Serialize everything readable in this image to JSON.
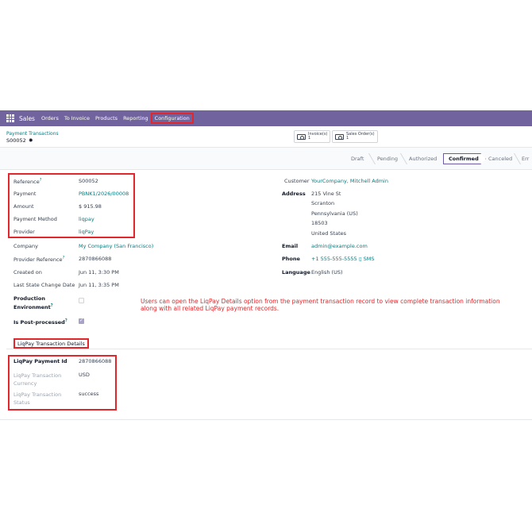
{
  "navbar": {
    "app_name": "Sales",
    "menu": [
      "Orders",
      "To Invoice",
      "Products",
      "Reporting",
      "Configuration"
    ]
  },
  "control_panel": {
    "breadcrumb_parent": "Payment Transactions",
    "record_name": "S00052",
    "smart_buttons": [
      {
        "label": "Invoice(s)",
        "count": "1"
      },
      {
        "label": "Sales Order(s)",
        "count": "1"
      }
    ]
  },
  "statusbar": {
    "stages": [
      "Draft",
      "Pending",
      "Authorized",
      "Confirmed",
      "Canceled",
      "Err"
    ],
    "active_stage": "Confirmed"
  },
  "form_left": {
    "reference_label": "Reference",
    "reference": "S00052",
    "payment_label": "Payment",
    "payment": "PBNK1/2026/00008",
    "amount_label": "Amount",
    "amount": "$ 915.98",
    "payment_method_label": "Payment Method",
    "payment_method": "liqpay",
    "provider_label": "Provider",
    "provider": "liqPay",
    "company_label": "Company",
    "company": "My Company (San Francisco)",
    "provider_reference_label": "Provider Reference",
    "provider_reference": "2870866088",
    "created_on_label": "Created on",
    "created_on": "Jun 11, 3:30 PM",
    "last_state_change_label": "Last State Change Date",
    "last_state_change": "Jun 11, 3:35 PM",
    "production_env_label_1": "Production",
    "production_env_label_2": "Environment",
    "production_env_checked": false,
    "post_processed_label": "Is Post-processed",
    "post_processed_checked": true
  },
  "form_right": {
    "customer_label": "Customer",
    "customer": "YourCompany, Mitchell Admin",
    "address_label": "Address",
    "address_lines": [
      "215 Vine St",
      "Scranton",
      "Pennsylvania (US)",
      "18503",
      "United States"
    ],
    "email_label": "Email",
    "email": "admin@example.com",
    "phone_label": "Phone",
    "phone": "+1 555-555-5555",
    "sms_label": "SMS",
    "language_label": "Language",
    "language": "English (US)"
  },
  "annotation": "Users can open the LiqPay Details option from the payment transaction record to view complete transaction information along with all related LiqPay payment records.",
  "notebook": {
    "tab_label": "LiqPay Transaction Details",
    "payment_id_label": "LiqPay Payment Id",
    "payment_id": "2870866088",
    "currency_label_1": "LiqPay Transaction",
    "currency_label_2": "Currency",
    "currency": "USD",
    "status_label_1": "LiqPay Transaction",
    "status_label_2": "Status",
    "status": "success"
  },
  "colors": {
    "navbar": "#71639e",
    "link": "#017e84",
    "highlight": "#e3262b"
  }
}
